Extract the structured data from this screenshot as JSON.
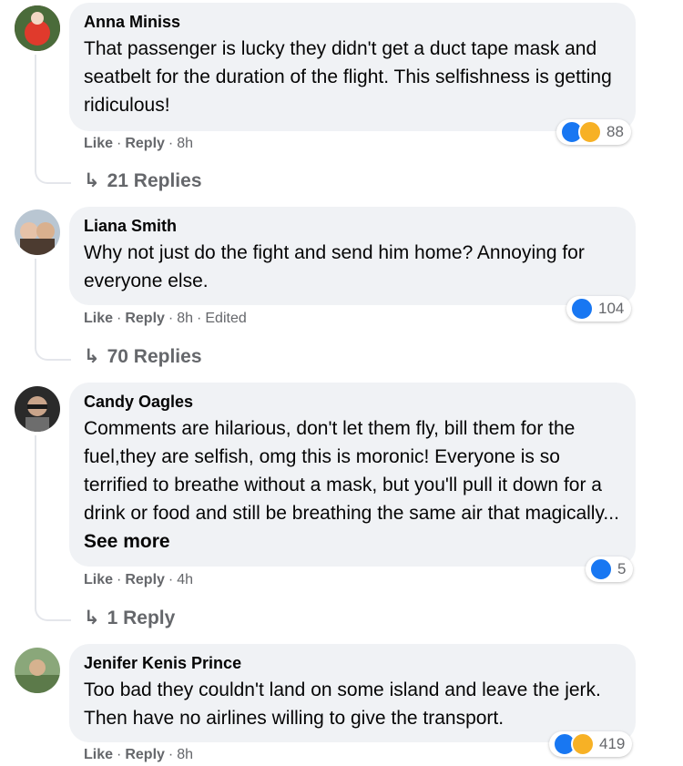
{
  "comments": [
    {
      "author": "Anna Miniss",
      "text": "That passenger is lucky they didn't get a duct tape mask and seatbelt for the duration of the flight. This selfishness is getting ridiculous!",
      "like_label": "Like",
      "reply_label": "Reply",
      "time": "8h",
      "edited": "",
      "reaction_count": "88",
      "reactions": [
        "like-icon",
        "haha-icon"
      ],
      "replies_label": "21 Replies"
    },
    {
      "author": "Liana Smith",
      "text": "Why not just do the fight and send him home? Annoying for everyone else.",
      "like_label": "Like",
      "reply_label": "Reply",
      "time": "8h",
      "edited": "Edited",
      "reaction_count": "104",
      "reactions": [
        "like-icon"
      ],
      "replies_label": "70 Replies"
    },
    {
      "author": "Candy Oagles",
      "text": "Comments are hilarious, don't let them fly, bill them for the fuel,they are selfish, omg this is moronic! Everyone is so terrified to breathe without a mask, but you'll pull it down for a drink or food and still be breathing the same air that magically...",
      "see_more": "See more",
      "like_label": "Like",
      "reply_label": "Reply",
      "time": "4h",
      "edited": "",
      "reaction_count": "5",
      "reactions": [
        "like-icon"
      ],
      "replies_label": "1 Reply"
    },
    {
      "author": "Jenifer Kenis Prince",
      "text": "Too bad they couldn't land on some island and leave the jerk. Then have no airlines willing to give the transport.",
      "like_label": "Like",
      "reply_label": "Reply",
      "time": "8h",
      "edited": "",
      "reaction_count": "419",
      "reactions": [
        "like-icon",
        "haha-icon"
      ],
      "replies_label": ""
    }
  ],
  "colors": {
    "bubble": "#f0f2f5",
    "meta_text": "#65676b",
    "like_blue": "#1877f2",
    "haha_yellow": "#f7b125"
  }
}
